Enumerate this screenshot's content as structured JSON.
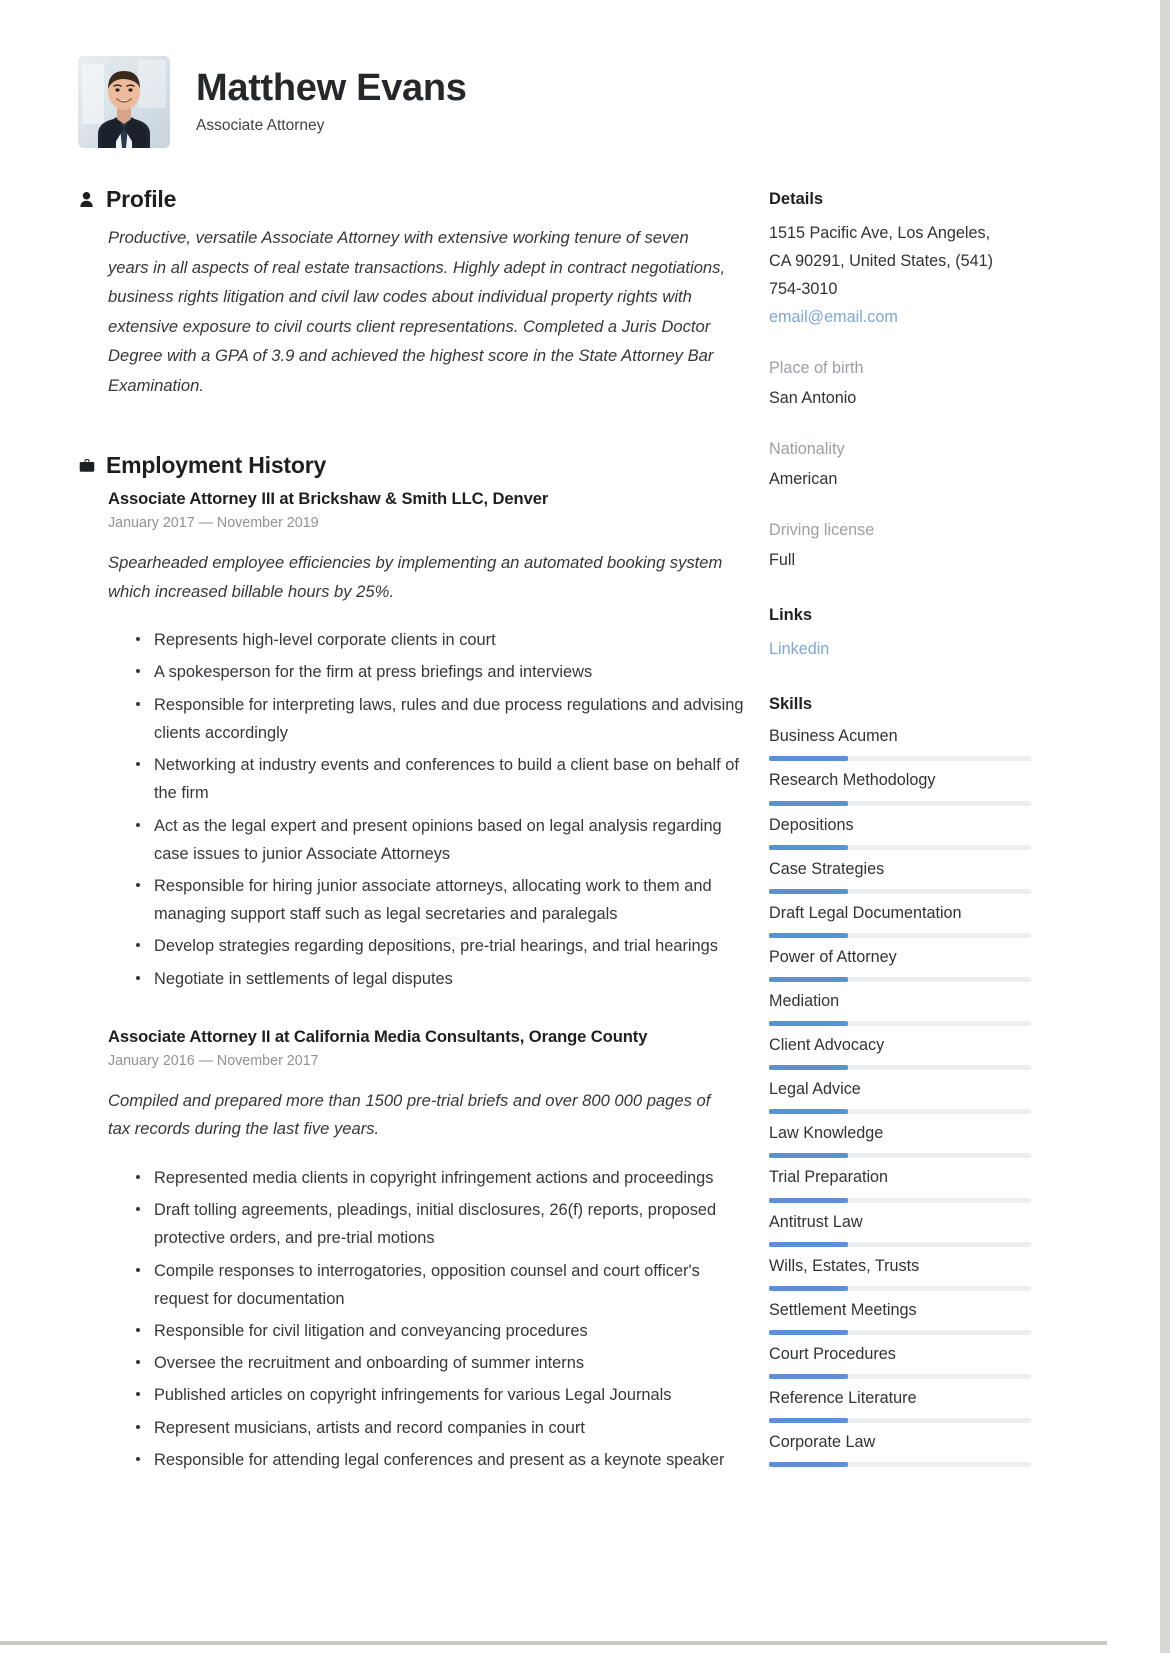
{
  "header": {
    "name": "Matthew Evans",
    "job_title": "Associate Attorney",
    "avatar_name": "profile-photo"
  },
  "profile": {
    "section_title": "Profile",
    "icon": "person-icon",
    "text": "Productive, versatile Associate Attorney with extensive working tenure of seven years in all aspects of real estate transactions. Highly adept in contract negotiations, business rights litigation and civil law codes about individual property rights with extensive exposure to civil courts client representations. Completed a Juris Doctor Degree with a GPA of 3.9 and achieved the highest score in the State Attorney Bar Examination."
  },
  "employment": {
    "section_title": "Employment History",
    "icon": "briefcase-icon",
    "jobs": [
      {
        "title": "Associate Attorney III at  Brickshaw & Smith LLC, Denver",
        "dates": "January 2017 — November 2019",
        "summary": "Spearheaded employee efficiencies by implementing an automated booking system which increased billable hours by 25%.",
        "bullets": [
          "Represents high-level corporate clients in court",
          "A spokesperson for the firm at press briefings and interviews",
          "Responsible for interpreting laws, rules and due process regulations and advising clients accordingly",
          "Networking at industry events and conferences to build a client base on behalf of the firm",
          "Act as the legal expert and present opinions based on legal analysis regarding case issues to junior Associate Attorneys",
          "Responsible for hiring junior associate attorneys, allocating work to them and managing support staff such as legal secretaries and paralegals",
          "Develop strategies regarding depositions, pre-trial hearings, and trial hearings",
          "Negotiate in settlements of legal disputes"
        ]
      },
      {
        "title": "Associate Attorney II at  California Media Consultants, Orange County",
        "dates": "January 2016 — November 2017",
        "summary": "Compiled and prepared more than 1500 pre-trial briefs and over 800 000 pages of tax records during the last five years.",
        "bullets": [
          "Represented media clients in copyright infringement actions and proceedings",
          "Draft tolling agreements, pleadings, initial disclosures, 26(f) reports, proposed protective orders, and pre-trial motions",
          "Compile responses to interrogatories, opposition counsel and court officer's request for documentation",
          "Responsible for civil litigation and conveyancing procedures",
          "Oversee the recruitment and onboarding of summer interns",
          "Published articles on copyright infringements for various Legal Journals",
          "Represent musicians, artists and record companies in court",
          "Responsible for attending legal conferences and present as a keynote speaker"
        ]
      }
    ]
  },
  "details": {
    "section_title": "Details",
    "address_lines": [
      "1515 Pacific Ave, Los Angeles,",
      "CA 90291, United States, (541)",
      "754-3010"
    ],
    "email": "email@email.com",
    "fields": [
      {
        "label": "Place of birth",
        "value": "San Antonio"
      },
      {
        "label": "Nationality",
        "value": "American"
      },
      {
        "label": "Driving license",
        "value": "Full"
      }
    ]
  },
  "links": {
    "section_title": "Links",
    "items": [
      {
        "label": "Linkedin"
      }
    ]
  },
  "skills": {
    "section_title": "Skills",
    "items": [
      {
        "label": "Business Acumen",
        "level": 30
      },
      {
        "label": "Research Methodology",
        "level": 30
      },
      {
        "label": "Depositions",
        "level": 30
      },
      {
        "label": "Case Strategies",
        "level": 30
      },
      {
        "label": "Draft Legal Documentation",
        "level": 30
      },
      {
        "label": "Power of Attorney",
        "level": 30
      },
      {
        "label": "Mediation",
        "level": 30
      },
      {
        "label": "Client Advocacy",
        "level": 30
      },
      {
        "label": "Legal Advice",
        "level": 30
      },
      {
        "label": "Law Knowledge",
        "level": 30
      },
      {
        "label": "Trial Preparation",
        "level": 30
      },
      {
        "label": "Antitrust Law",
        "level": 30
      },
      {
        "label": "Wills, Estates, Trusts",
        "level": 30
      },
      {
        "label": "Settlement Meetings",
        "level": 30
      },
      {
        "label": "Court Procedures",
        "level": 30
      },
      {
        "label": "Reference Literature",
        "level": 30
      },
      {
        "label": "Corporate Law",
        "level": 30
      }
    ]
  },
  "colors": {
    "accent": "#5b90d4",
    "link": "#7fa8d6",
    "track": "#eceef0",
    "text": "#34383c",
    "muted": "#9aa0a6",
    "page_bg": "#d8d8d4"
  }
}
